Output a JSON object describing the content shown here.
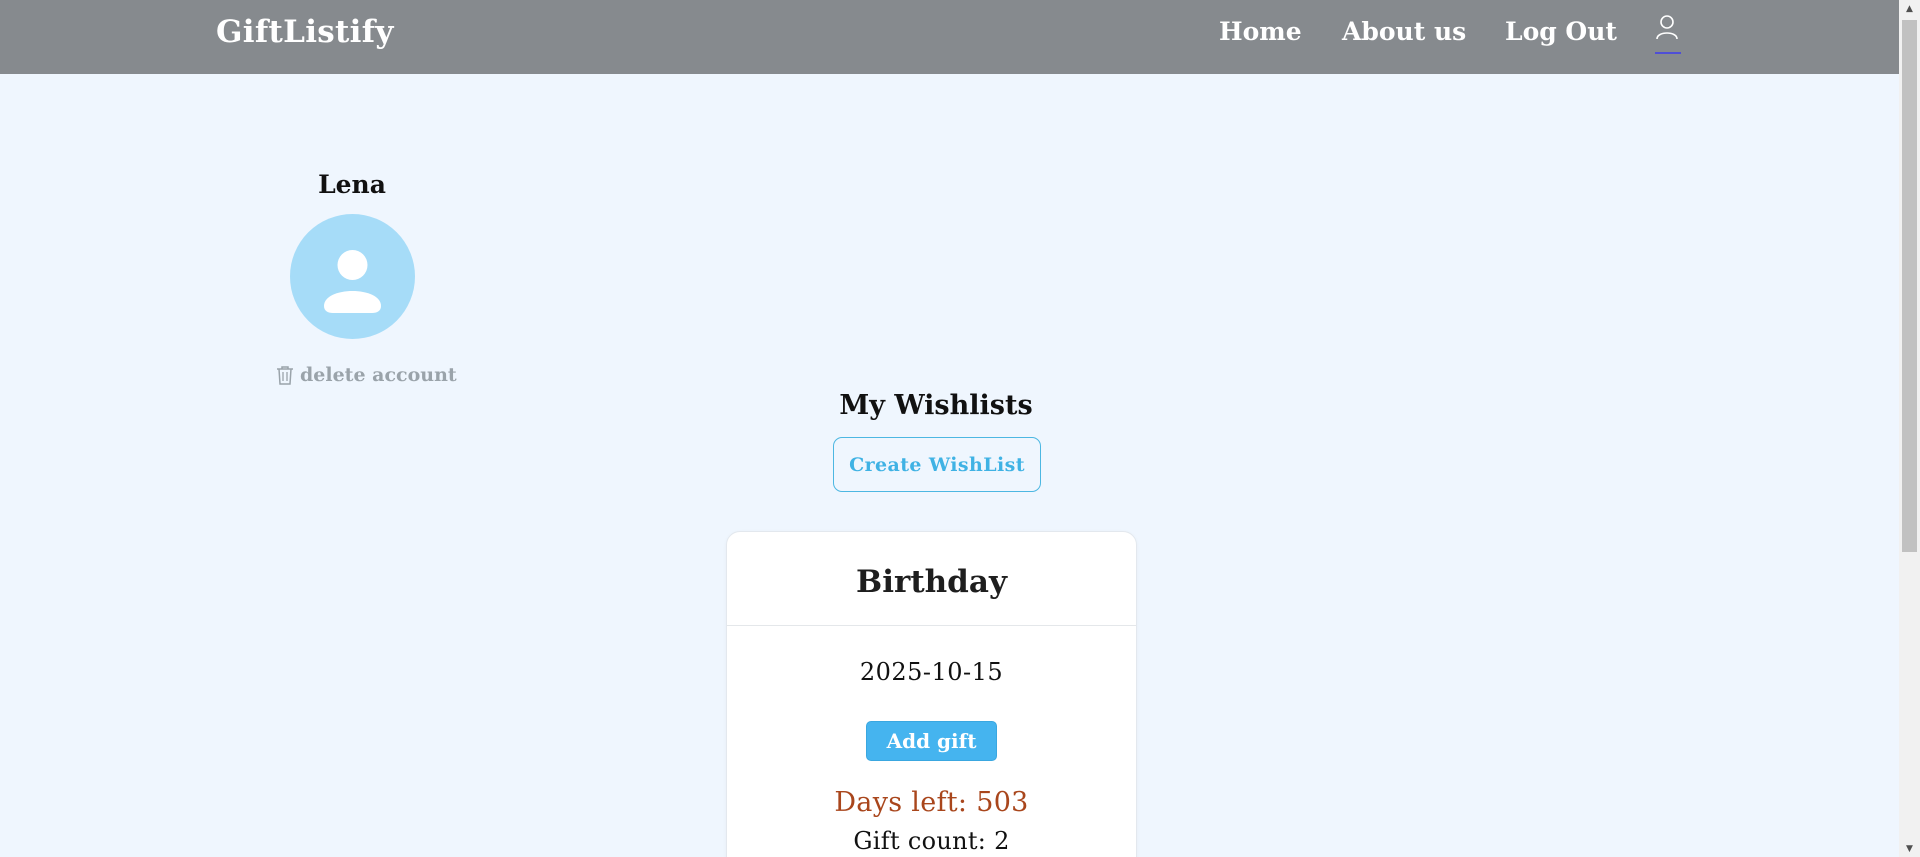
{
  "navbar": {
    "brand": "GiftListify",
    "links": {
      "home": "Home",
      "about": "About us",
      "logout": "Log Out"
    },
    "user_icon": "user-icon",
    "active_underline_color": "#4f4fd6"
  },
  "profile": {
    "name": "Lena",
    "avatar_icon": "person-icon",
    "delete_label": "delete account",
    "delete_icon": "trash-icon"
  },
  "wishlists": {
    "title": "My Wishlists",
    "create_label": "Create WishList",
    "cards": [
      {
        "title": "Birthday",
        "date": "2025-10-15",
        "add_gift_label": "Add gift",
        "days_left": "Days left: 503",
        "gift_count": "Gift count: 2"
      }
    ]
  },
  "colors": {
    "background": "#eff6fe",
    "navbar": "#868a8e",
    "accent": "#45b4ef",
    "days_left": "#a9461c",
    "avatar": "#a6dcf8"
  }
}
